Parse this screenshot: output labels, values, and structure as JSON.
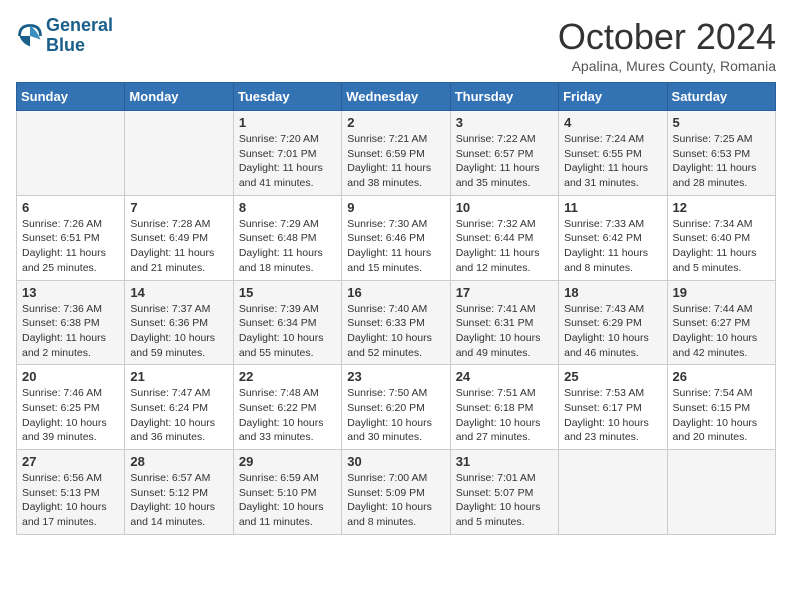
{
  "header": {
    "logo_line1": "General",
    "logo_line2": "Blue",
    "month": "October 2024",
    "location": "Apalina, Mures County, Romania"
  },
  "days_of_week": [
    "Sunday",
    "Monday",
    "Tuesday",
    "Wednesday",
    "Thursday",
    "Friday",
    "Saturday"
  ],
  "weeks": [
    [
      {
        "day": "",
        "info": ""
      },
      {
        "day": "",
        "info": ""
      },
      {
        "day": "1",
        "info": "Sunrise: 7:20 AM\nSunset: 7:01 PM\nDaylight: 11 hours and 41 minutes."
      },
      {
        "day": "2",
        "info": "Sunrise: 7:21 AM\nSunset: 6:59 PM\nDaylight: 11 hours and 38 minutes."
      },
      {
        "day": "3",
        "info": "Sunrise: 7:22 AM\nSunset: 6:57 PM\nDaylight: 11 hours and 35 minutes."
      },
      {
        "day": "4",
        "info": "Sunrise: 7:24 AM\nSunset: 6:55 PM\nDaylight: 11 hours and 31 minutes."
      },
      {
        "day": "5",
        "info": "Sunrise: 7:25 AM\nSunset: 6:53 PM\nDaylight: 11 hours and 28 minutes."
      }
    ],
    [
      {
        "day": "6",
        "info": "Sunrise: 7:26 AM\nSunset: 6:51 PM\nDaylight: 11 hours and 25 minutes."
      },
      {
        "day": "7",
        "info": "Sunrise: 7:28 AM\nSunset: 6:49 PM\nDaylight: 11 hours and 21 minutes."
      },
      {
        "day": "8",
        "info": "Sunrise: 7:29 AM\nSunset: 6:48 PM\nDaylight: 11 hours and 18 minutes."
      },
      {
        "day": "9",
        "info": "Sunrise: 7:30 AM\nSunset: 6:46 PM\nDaylight: 11 hours and 15 minutes."
      },
      {
        "day": "10",
        "info": "Sunrise: 7:32 AM\nSunset: 6:44 PM\nDaylight: 11 hours and 12 minutes."
      },
      {
        "day": "11",
        "info": "Sunrise: 7:33 AM\nSunset: 6:42 PM\nDaylight: 11 hours and 8 minutes."
      },
      {
        "day": "12",
        "info": "Sunrise: 7:34 AM\nSunset: 6:40 PM\nDaylight: 11 hours and 5 minutes."
      }
    ],
    [
      {
        "day": "13",
        "info": "Sunrise: 7:36 AM\nSunset: 6:38 PM\nDaylight: 11 hours and 2 minutes."
      },
      {
        "day": "14",
        "info": "Sunrise: 7:37 AM\nSunset: 6:36 PM\nDaylight: 10 hours and 59 minutes."
      },
      {
        "day": "15",
        "info": "Sunrise: 7:39 AM\nSunset: 6:34 PM\nDaylight: 10 hours and 55 minutes."
      },
      {
        "day": "16",
        "info": "Sunrise: 7:40 AM\nSunset: 6:33 PM\nDaylight: 10 hours and 52 minutes."
      },
      {
        "day": "17",
        "info": "Sunrise: 7:41 AM\nSunset: 6:31 PM\nDaylight: 10 hours and 49 minutes."
      },
      {
        "day": "18",
        "info": "Sunrise: 7:43 AM\nSunset: 6:29 PM\nDaylight: 10 hours and 46 minutes."
      },
      {
        "day": "19",
        "info": "Sunrise: 7:44 AM\nSunset: 6:27 PM\nDaylight: 10 hours and 42 minutes."
      }
    ],
    [
      {
        "day": "20",
        "info": "Sunrise: 7:46 AM\nSunset: 6:25 PM\nDaylight: 10 hours and 39 minutes."
      },
      {
        "day": "21",
        "info": "Sunrise: 7:47 AM\nSunset: 6:24 PM\nDaylight: 10 hours and 36 minutes."
      },
      {
        "day": "22",
        "info": "Sunrise: 7:48 AM\nSunset: 6:22 PM\nDaylight: 10 hours and 33 minutes."
      },
      {
        "day": "23",
        "info": "Sunrise: 7:50 AM\nSunset: 6:20 PM\nDaylight: 10 hours and 30 minutes."
      },
      {
        "day": "24",
        "info": "Sunrise: 7:51 AM\nSunset: 6:18 PM\nDaylight: 10 hours and 27 minutes."
      },
      {
        "day": "25",
        "info": "Sunrise: 7:53 AM\nSunset: 6:17 PM\nDaylight: 10 hours and 23 minutes."
      },
      {
        "day": "26",
        "info": "Sunrise: 7:54 AM\nSunset: 6:15 PM\nDaylight: 10 hours and 20 minutes."
      }
    ],
    [
      {
        "day": "27",
        "info": "Sunrise: 6:56 AM\nSunset: 5:13 PM\nDaylight: 10 hours and 17 minutes."
      },
      {
        "day": "28",
        "info": "Sunrise: 6:57 AM\nSunset: 5:12 PM\nDaylight: 10 hours and 14 minutes."
      },
      {
        "day": "29",
        "info": "Sunrise: 6:59 AM\nSunset: 5:10 PM\nDaylight: 10 hours and 11 minutes."
      },
      {
        "day": "30",
        "info": "Sunrise: 7:00 AM\nSunset: 5:09 PM\nDaylight: 10 hours and 8 minutes."
      },
      {
        "day": "31",
        "info": "Sunrise: 7:01 AM\nSunset: 5:07 PM\nDaylight: 10 hours and 5 minutes."
      },
      {
        "day": "",
        "info": ""
      },
      {
        "day": "",
        "info": ""
      }
    ]
  ]
}
